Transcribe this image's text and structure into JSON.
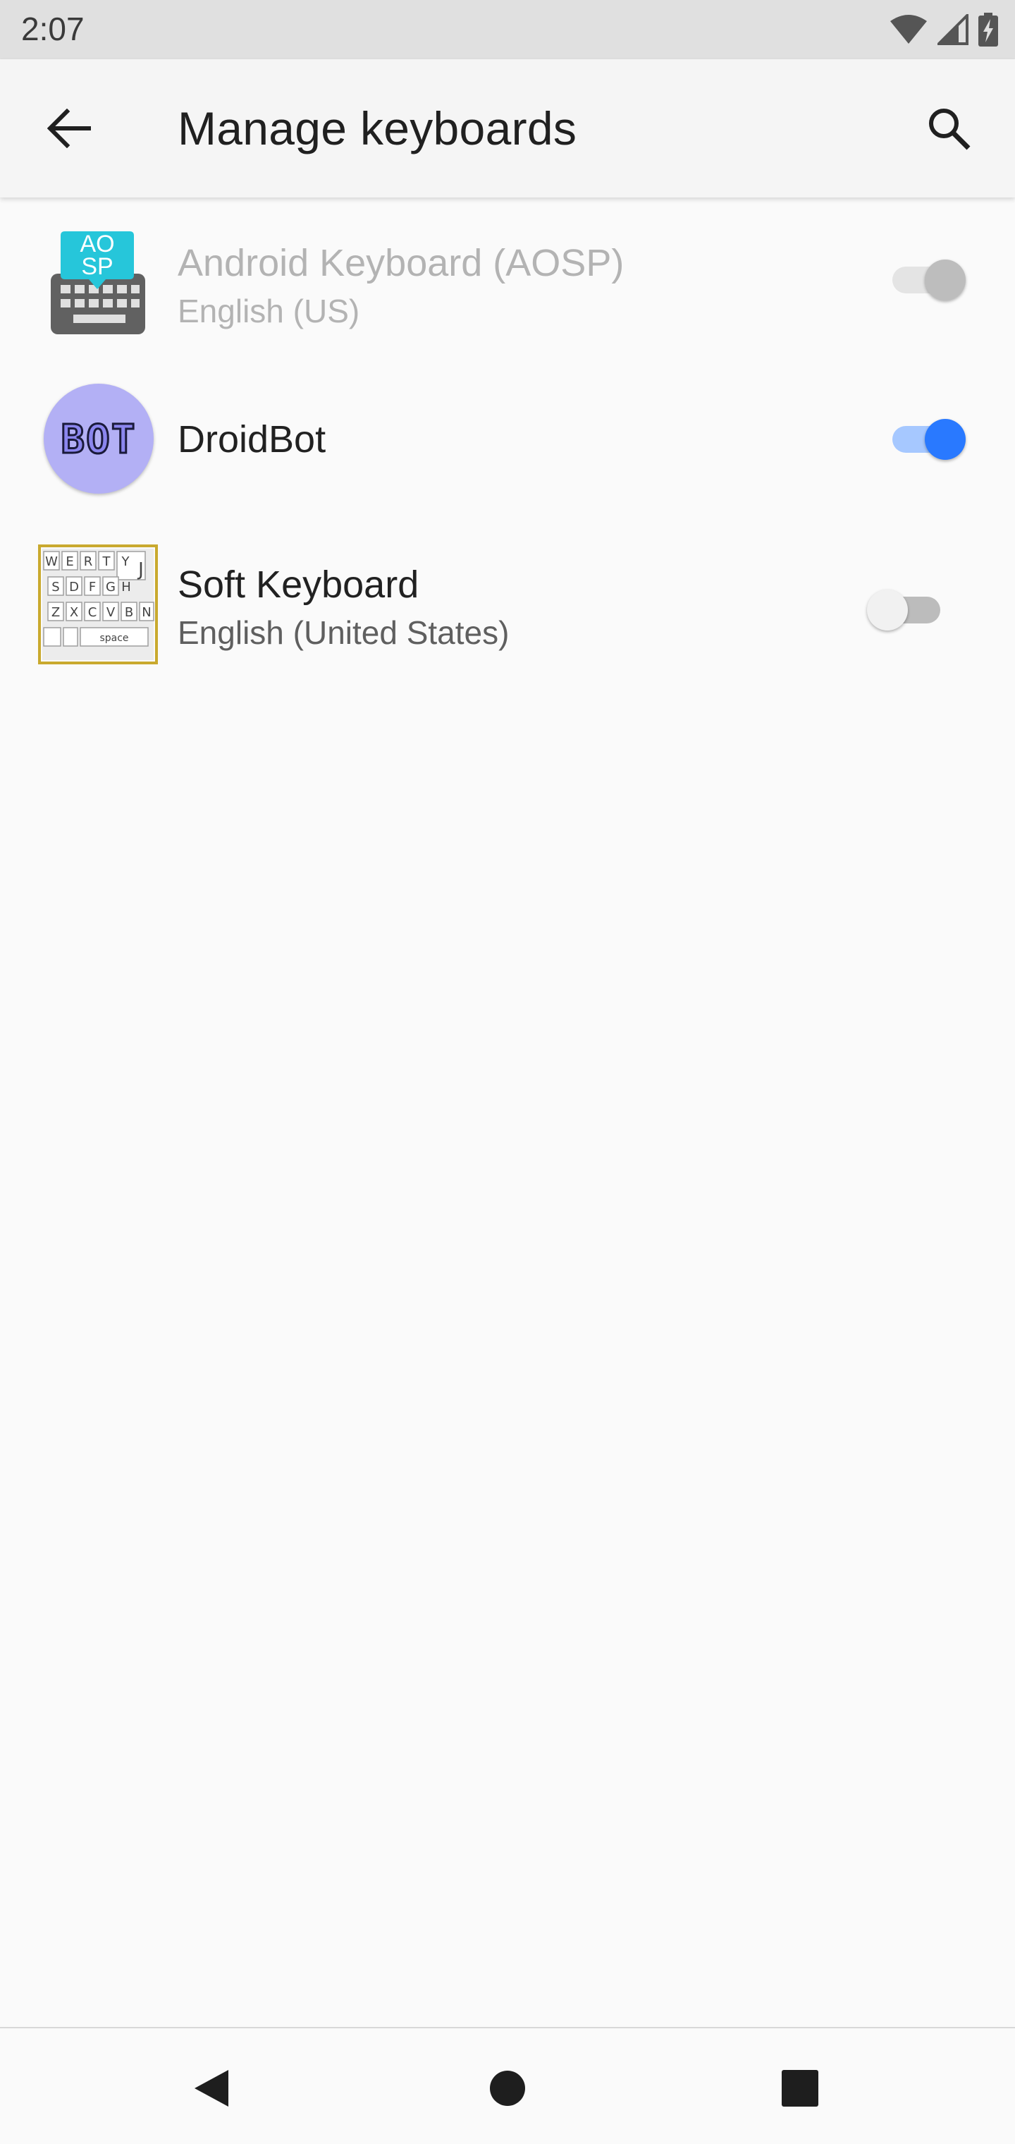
{
  "status_bar": {
    "time": "2:07",
    "icons": [
      "wifi-icon",
      "signal-icon",
      "battery-charging-icon"
    ]
  },
  "app_bar": {
    "title": "Manage keyboards",
    "back_icon": "arrow-back-icon",
    "search_icon": "search-icon"
  },
  "keyboards": [
    {
      "title": "Android Keyboard (AOSP)",
      "subtitle": "English (US)",
      "icon": "aosp-keyboard-icon",
      "icon_badge": "AO SP",
      "enabled": true,
      "toggle_disabled": true
    },
    {
      "title": "DroidBot",
      "subtitle": "",
      "icon": "droidbot-icon",
      "icon_text": "BOT",
      "enabled": true,
      "toggle_disabled": false
    },
    {
      "title": "Soft Keyboard",
      "subtitle": "English (United States)",
      "icon": "soft-keyboard-icon",
      "icon_keys": "space",
      "enabled": false,
      "toggle_disabled": false
    }
  ],
  "colors": {
    "accent": "#2979ff",
    "accent_track": "#a6c8ff",
    "disabled_thumb": "#bdbdbd",
    "disabled_track": "#e4e4e4",
    "off_thumb": "#f1f1f1",
    "off_track": "#bcbcbc",
    "droidbot_bg": "#b3b0f5"
  },
  "nav_bar": {
    "back": "nav-back-icon",
    "home": "nav-home-icon",
    "recents": "nav-recents-icon"
  }
}
